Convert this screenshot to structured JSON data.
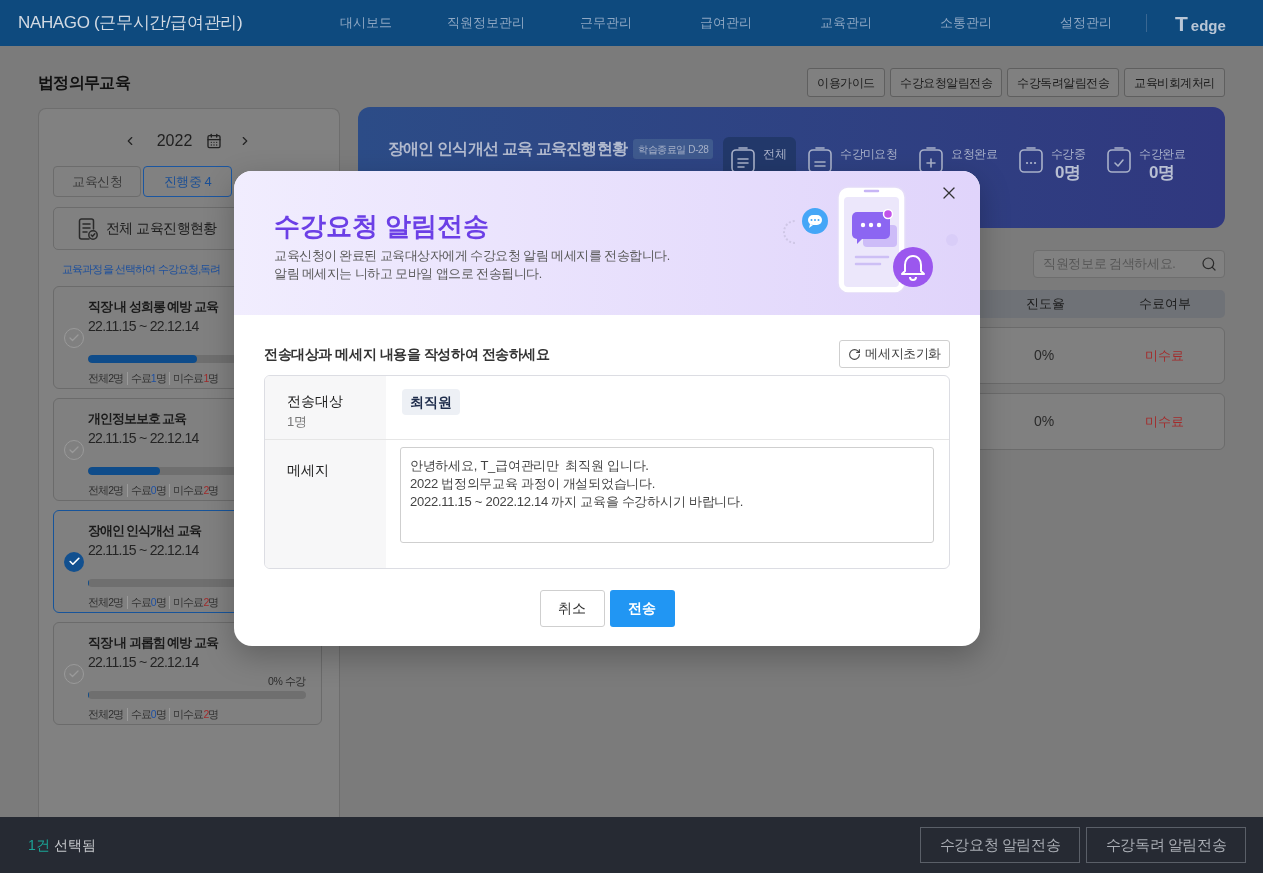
{
  "top_bar": {
    "title": "NAHAGO (근무시간/급여관리)",
    "nav": [
      {
        "label": "대시보드"
      },
      {
        "label": "직원정보관리"
      },
      {
        "label": "근무관리"
      },
      {
        "label": "급여관리"
      },
      {
        "label": "교육관리"
      },
      {
        "label": "소통관리"
      },
      {
        "label": "설정관리"
      }
    ],
    "logo": {
      "mark": "T",
      "text": "edge"
    }
  },
  "page": {
    "title": "법정의무교육",
    "actions": [
      "이용가이드",
      "수강요청알림전송",
      "수강독려알림전송",
      "교육비회계처리"
    ]
  },
  "course_panel": {
    "year": "2022",
    "tabs": [
      {
        "label": "교육신청",
        "selected": false
      },
      {
        "label": "진행중 4",
        "selected": true
      }
    ],
    "overview_button": "전체 교육진행현황",
    "hint": "교육과정을 선택하여 수강요청,독려",
    "courses": [
      {
        "title": "직장 내 성희롱 예방 교육",
        "period": "22.11.15 ~ 22.12.14",
        "selected": false,
        "level": 0.5,
        "stats": [
          {
            "kind": "total",
            "label": "전체",
            "count": "2",
            "unit": "명"
          },
          {
            "kind": "done",
            "label": "수료",
            "count": "1",
            "unit": "명"
          },
          {
            "kind": "undone",
            "label": "미수료",
            "count": "1",
            "unit": "명"
          }
        ]
      },
      {
        "title": "개인정보보호 교육",
        "period": "22.11.15 ~ 22.12.14",
        "selected": false,
        "level": 0.33,
        "stats": [
          {
            "kind": "total",
            "label": "전체",
            "count": "2",
            "unit": "명"
          },
          {
            "kind": "done",
            "label": "수료",
            "count": "0",
            "unit": "명"
          },
          {
            "kind": "undone",
            "label": "미수료",
            "count": "2",
            "unit": "명"
          }
        ]
      },
      {
        "title": "장애인 인식개선 교육",
        "period": "22.11.15 ~ 22.12.14",
        "selected": true,
        "level": 0,
        "stats": [
          {
            "kind": "total",
            "label": "전체",
            "count": "2",
            "unit": "명"
          },
          {
            "kind": "done",
            "label": "수료",
            "count": "0",
            "unit": "명"
          },
          {
            "kind": "undone",
            "label": "미수료",
            "count": "2",
            "unit": "명"
          }
        ]
      },
      {
        "title": "직장 내 괴롭힘 예방 교육",
        "period": "22.11.15 ~ 22.12.14",
        "selected": false,
        "level": 0,
        "progress_label": "0% 수강",
        "stats": [
          {
            "kind": "total",
            "label": "전체",
            "count": "2",
            "unit": "명"
          },
          {
            "kind": "done",
            "label": "수료",
            "count": "0",
            "unit": "명"
          },
          {
            "kind": "undone",
            "label": "미수료",
            "count": "2",
            "unit": "명"
          }
        ]
      }
    ]
  },
  "progress_banner": {
    "title": "장애인 인식개선 교육 교육진행현황",
    "badge": "학습종료일 D-28",
    "stats": [
      {
        "kind": "all",
        "label": "전체",
        "selected": true
      },
      {
        "kind": "pending",
        "label": "수강미요청",
        "selected": false
      },
      {
        "kind": "requested",
        "label": "요청완료",
        "selected": false
      },
      {
        "kind": "ongoing",
        "label": "수강중",
        "value": "0명",
        "selected": false
      },
      {
        "kind": "done",
        "label": "수강완료",
        "value": "0명",
        "selected": false
      }
    ]
  },
  "employee_table": {
    "search": {
      "placeholder": "직원정보로 검색하세요."
    },
    "columns": [
      "진도율",
      "수료여부"
    ],
    "rows": [
      {
        "progress": "0%",
        "status": "미수료",
        "completed": false
      },
      {
        "progress": "0%",
        "status": "미수료",
        "completed": false
      }
    ]
  },
  "bottom_bar": {
    "count": "1건",
    "label": "선택됨",
    "buttons": [
      "수강요청 알림전송",
      "수강독려 알림전송"
    ]
  },
  "dialog": {
    "title": "수강요청 알림전송",
    "description": [
      "교육신청이 완료된 교육대상자에게 수강요청 알림 메세지를 전송합니다.",
      "알림 메세지는 니하고 모바일 앱으로 전송됩니다."
    ],
    "instruction": "전송대상과 메세지 내용을 작성하여 전송하세요",
    "reset_button": "메세지초기화",
    "recipients": {
      "label": "전송대상",
      "count": "1명",
      "names": [
        "최직원"
      ]
    },
    "message": {
      "label": "메세지",
      "value": "안녕하세요, T_급여관리만  최직원 입니다.\n2022 법정의무교육 과정이 개설되었습니다.\n2022.11.15 ~ 2022.12.14 까지 교육을 수강하시기 바랍니다."
    },
    "buttons": [
      {
        "kind": "secondary",
        "label": "취소"
      },
      {
        "kind": "primary",
        "label": "전송"
      }
    ]
  }
}
